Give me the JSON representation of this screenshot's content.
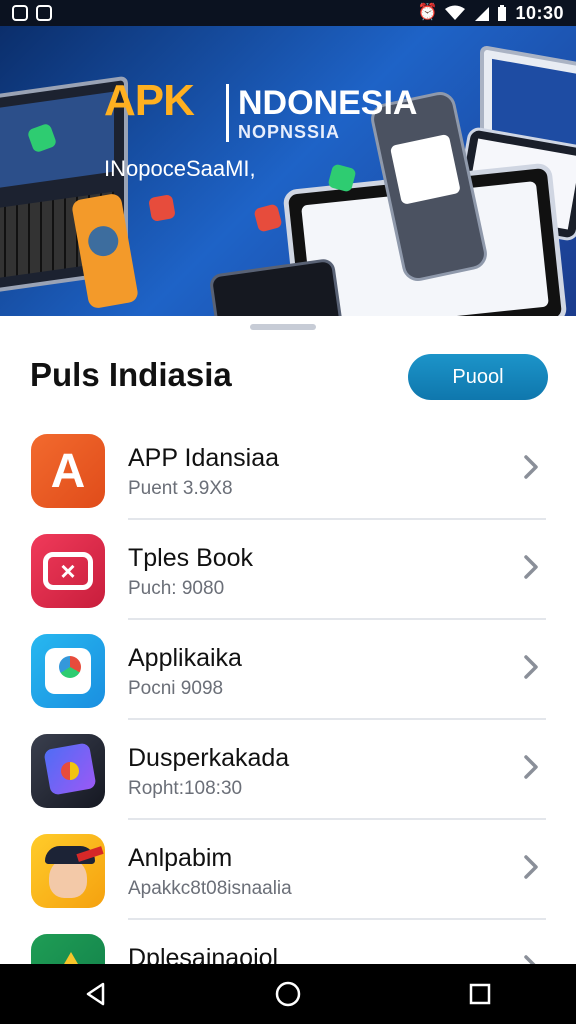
{
  "status_bar": {
    "time": "10:30",
    "left_icons": [
      "notification-icon",
      "image-icon"
    ],
    "right_icons": [
      "alarm-icon",
      "wifi-icon",
      "signal-icon",
      "battery-icon"
    ]
  },
  "banner": {
    "title": "APK",
    "subtitle": "NDONESIA",
    "subtitle2": "NOPNSSIA",
    "tagline": "INopoceSaaMI,"
  },
  "list_header": {
    "title": "Puls Indiasia",
    "button_label": "Puool"
  },
  "apps": [
    {
      "name": "APP Idansiaa",
      "sub": "Puent 3.9X8",
      "icon": "app-a-icon",
      "color": "#f26a2e"
    },
    {
      "name": "Tples Book",
      "sub": "Puch: 9080",
      "icon": "video-icon",
      "color": "#f03a5a"
    },
    {
      "name": "Applikaika",
      "sub": "Pocni 9098",
      "icon": "maps-icon",
      "color": "#27b8f0"
    },
    {
      "name": "Dusperkakada",
      "sub": "Ropht:108:30",
      "icon": "gallery-icon",
      "color": "#3a3f4e"
    },
    {
      "name": "Anlpabim",
      "sub": "Apakkc8t08isnaalia",
      "icon": "avatar-icon",
      "color": "#ffcc2a"
    },
    {
      "name": "Dplesainaoiol",
      "sub": "",
      "icon": "drive-icon",
      "color": "#1f9d55"
    }
  ],
  "nav": [
    "back-icon",
    "home-icon",
    "recents-icon"
  ]
}
